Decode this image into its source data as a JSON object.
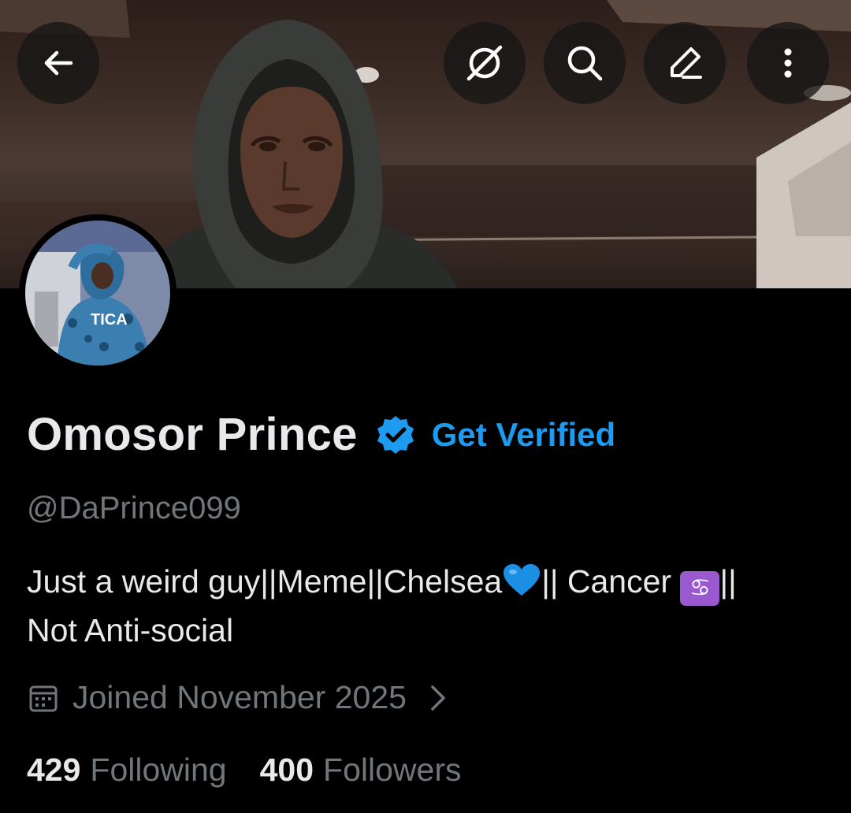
{
  "header": {
    "back_icon": "arrow-left-icon",
    "grok_icon": "grok-icon",
    "search_icon": "search-icon",
    "edit_icon": "pencil-icon",
    "more_icon": "more-vertical-icon"
  },
  "banner": {
    "description_icon": "banner-photo"
  },
  "profile": {
    "name": "Omosor Prince",
    "get_verified": "Get Verified",
    "handle": "@DaPrince099",
    "bio_part1": "Just a weird guy||Meme||Chelsea",
    "bio_part2": "||  Cancer ",
    "bio_part3": "||",
    "bio_line2": "Not Anti-social",
    "cancer_glyph": "♋",
    "avatar_text": "TICA",
    "joined": "Joined November 2025"
  },
  "stats": {
    "following_count": "429",
    "following_label": "Following",
    "followers_count": "400",
    "followers_label": "Followers"
  },
  "colors": {
    "accent": "#1d9bf0",
    "secondary_text": "#71767b",
    "primary_text": "#e7e9ea",
    "background": "#000000"
  }
}
